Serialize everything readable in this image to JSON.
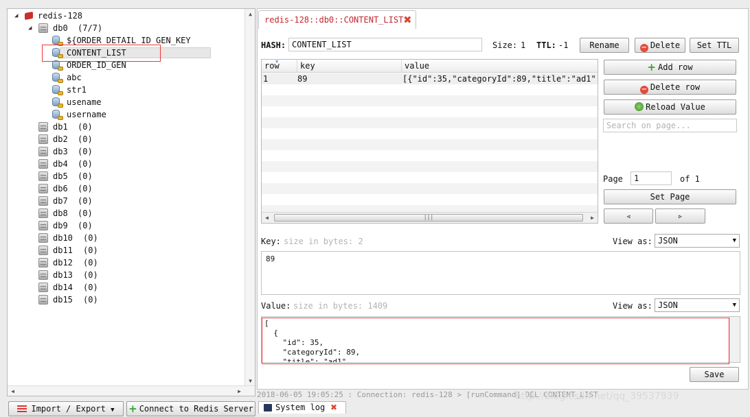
{
  "tree": {
    "server": "redis-128",
    "db0": {
      "name": "db0",
      "count": "(7/7)",
      "keys": [
        "${ORDER_DETAIL_ID_GEN_KEY",
        "CONTENT_LIST",
        "ORDER_ID_GEN",
        "abc",
        "str1",
        "usename",
        "username"
      ]
    },
    "other_dbs": [
      {
        "name": "db1",
        "count": "(0)"
      },
      {
        "name": "db2",
        "count": "(0)"
      },
      {
        "name": "db3",
        "count": "(0)"
      },
      {
        "name": "db4",
        "count": "(0)"
      },
      {
        "name": "db5",
        "count": "(0)"
      },
      {
        "name": "db6",
        "count": "(0)"
      },
      {
        "name": "db7",
        "count": "(0)"
      },
      {
        "name": "db8",
        "count": "(0)"
      },
      {
        "name": "db9",
        "count": "(0)"
      },
      {
        "name": "db10",
        "count": "(0)"
      },
      {
        "name": "db11",
        "count": "(0)"
      },
      {
        "name": "db12",
        "count": "(0)"
      },
      {
        "name": "db13",
        "count": "(0)"
      },
      {
        "name": "db14",
        "count": "(0)"
      },
      {
        "name": "db15",
        "count": "(0)"
      }
    ]
  },
  "bottom_left": {
    "import_export": "Import / Export",
    "connect": "Connect to Redis Server"
  },
  "tab": {
    "title": "redis-128::db0::CONTENT_LIST"
  },
  "key_header": {
    "type_label": "HASH:",
    "key_name": "CONTENT_LIST",
    "size_label": "Size:",
    "size_value": "1",
    "ttl_label": "TTL:",
    "ttl_value": "-1",
    "rename": "Rename",
    "delete": "Delete",
    "set_ttl": "Set TTL"
  },
  "table": {
    "columns": [
      "row",
      "key",
      "value"
    ],
    "rows": [
      {
        "row": "1",
        "key": "89",
        "value": "[{\"id\":35,\"categoryId\":89,\"title\":\"ad1\"···"
      }
    ]
  },
  "side_actions": {
    "add_row": "Add row",
    "delete_row": "Delete row",
    "reload_value": "Reload Value",
    "search_placeholder": "Search on page...",
    "page_label": "Page",
    "page_value": "1",
    "of_label": "of 1",
    "set_page": "Set Page",
    "prev": "◃",
    "next": "▹"
  },
  "key_editor": {
    "label": "Key:",
    "hint": "size in bytes: 2",
    "view_as_label": "View as:",
    "format": "JSON",
    "content": "89"
  },
  "value_editor": {
    "label": "Value:",
    "hint": "size in bytes: 1409",
    "view_as_label": "View as:",
    "format": "JSON",
    "content": "[\n  {\n    \"id\": 35,\n    \"categoryId\": 89,\n    \"title\": \"ad1\","
  },
  "save": "Save",
  "status": {
    "log_line": "2018-06-05 19:05:25 : Connection: redis-128 > [runCommand] DEL CONTENT_LIST",
    "log_tab": "System log"
  },
  "watermark": "http://blog.csdn.net/qq_39537939",
  "colors": {
    "tab_title": "#c1272d",
    "highlight": "#e33333",
    "red_icon": "#e54b3c",
    "green_icon": "#2fa52f"
  }
}
